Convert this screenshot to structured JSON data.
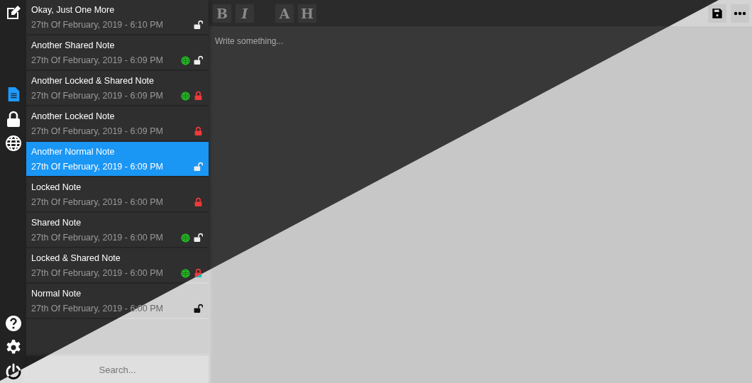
{
  "sidebar": {
    "filters": [
      {
        "kind": "all",
        "selected": true
      },
      {
        "kind": "locked",
        "selected": false
      },
      {
        "kind": "shared",
        "selected": false
      }
    ]
  },
  "notes": [
    {
      "title": "Okay, Just One More",
      "date": "27th Of February, 2019 - 6:10 PM",
      "shared": false,
      "locked": false,
      "selected": false
    },
    {
      "title": "Another Shared Note",
      "date": "27th Of February, 2019 - 6:09 PM",
      "shared": true,
      "locked": false,
      "selected": false
    },
    {
      "title": "Another Locked & Shared Note",
      "date": "27th Of February, 2019 - 6:09 PM",
      "shared": true,
      "locked": true,
      "selected": false
    },
    {
      "title": "Another Locked Note",
      "date": "27th Of February, 2019 - 6:09 PM",
      "shared": false,
      "locked": true,
      "selected": false
    },
    {
      "title": "Another Normal Note",
      "date": "27th Of February, 2019 - 6:09 PM",
      "shared": false,
      "locked": false,
      "selected": true
    },
    {
      "title": "Locked Note",
      "date": "27th Of February, 2019 - 6:00 PM",
      "shared": false,
      "locked": true,
      "selected": false
    },
    {
      "title": "Shared Note",
      "date": "27th Of February, 2019 - 6:00 PM",
      "shared": true,
      "locked": false,
      "selected": false
    },
    {
      "title": "Locked & Shared Note",
      "date": "27th Of February, 2019 - 6:00 PM",
      "shared": true,
      "locked": true,
      "selected": false
    },
    {
      "title": "Normal Note",
      "date": "27th Of February, 2019 - 6:00 PM",
      "shared": false,
      "locked": false,
      "selected": false
    }
  ],
  "search": {
    "placeholder": "Search..."
  },
  "toolbar": {
    "groups": [
      [
        "B",
        "I"
      ],
      [
        "A",
        "H"
      ]
    ]
  },
  "editor": {
    "placeholder": "Write something..."
  }
}
